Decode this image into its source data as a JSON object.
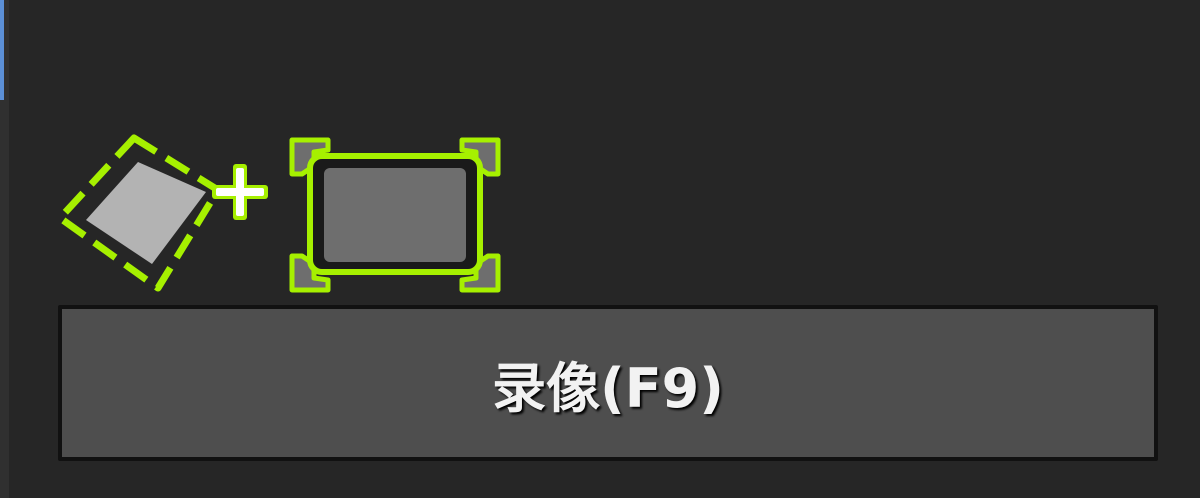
{
  "toolbar": {
    "add_region_icon": "add-region-icon",
    "fullscreen_icon": "fullscreen-region-icon"
  },
  "record_button": {
    "label": "录像(F9)"
  },
  "colors": {
    "background": "#262626",
    "accent": "#a6f000",
    "button_face": "#4e4e4e",
    "button_text": "#f2f2f2"
  }
}
